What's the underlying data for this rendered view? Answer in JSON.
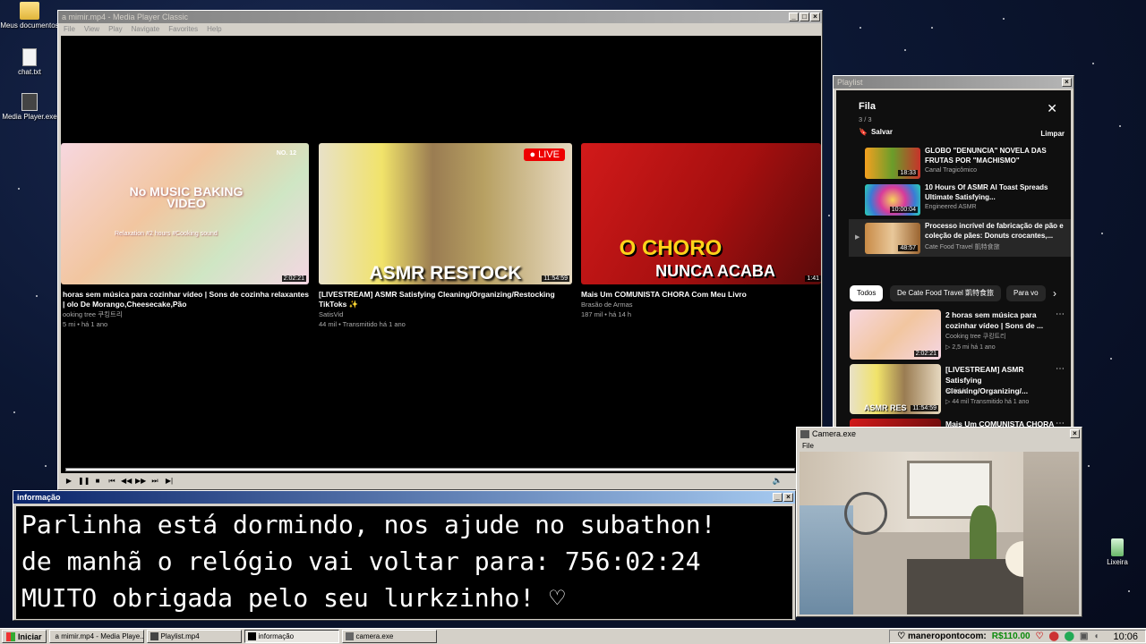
{
  "desktop": {
    "icons": [
      {
        "label": "Meus documentos"
      },
      {
        "label": "chat.txt"
      },
      {
        "label": "Media Player.exe"
      },
      {
        "label": "Lixeira"
      }
    ]
  },
  "mpc": {
    "title": "a mimir.mp4 - Media Player Classic",
    "menu": [
      "File",
      "View",
      "Play",
      "Navigate",
      "Favorites",
      "Help"
    ],
    "videos": [
      {
        "title": "horas sem música para cozinhar vídeo | Sons de cozinha relaxantes | olo De Morango,Cheesecake,Pão",
        "channel": "ooking tree 쿠킹트리",
        "meta": "5 mi • há 1 ano",
        "duration": "2:02:21",
        "thumb_text": "No MUSIC BAKING VIDEO",
        "thumb_sub": "Relaxation #2 hours #Cooking sound",
        "thumb_badge": "NO. 12"
      },
      {
        "title": "[LIVESTREAM] ASMR Satisfying Cleaning/Organizing/Restocking TikToks ✨",
        "channel": "SatisVid",
        "meta": "44 mil • Transmitido há 1 ano",
        "duration": "11:54:59",
        "thumb_text": "ASMR RESTOCK",
        "live_label": "LIVE"
      },
      {
        "title": "Mais Um COMUNISTA CHORA Com Meu Livro",
        "channel": "Brasão de Armas",
        "meta": "187 mil • há 14 h",
        "duration": "1:41",
        "thumb_text_1": "O CHORO",
        "thumb_text_2": "NUNCA ACABA"
      }
    ]
  },
  "playlist": {
    "window_title": "Playlist",
    "header": "Fila",
    "count": "3 / 3",
    "save_label": "Salvar",
    "clear_label": "Limpar",
    "queue": [
      {
        "title": "GLOBO \"DENUNCIA\" NOVELA DAS FRUTAS POR \"MACHISMO\"",
        "channel": "Canal Tragicômico",
        "duration": "18:33"
      },
      {
        "title": "10 Hours Of ASMR AI Toast Spreads Ultimate Satisfying...",
        "channel": "Engineered ASMR",
        "duration": "10:00:04"
      },
      {
        "title": "Processo incrível de fabricação de pão e coleção de pães: Donuts crocantes,...",
        "channel": "Cate Food Travel 凱特食旅",
        "duration": "48:57"
      }
    ],
    "chips": [
      "Todos",
      "De Cate Food Travel 凱特食旅",
      "Para vo"
    ],
    "related": [
      {
        "title": "2 horas sem música para cozinhar vídeo | Sons de ...",
        "channel": "Cooking tree 쿠킹트리",
        "meta": "▷ 2,5 mi   há 1 ano",
        "duration": "2:02:21"
      },
      {
        "title": "[LIVESTREAM] ASMR Satisfying Cleaning/Organizing/...",
        "channel": "SatisVid",
        "meta": "▷ 44 mil   Transmitido há 1 ano",
        "duration": "11:54:59",
        "thumb_text": "ASMR RES"
      },
      {
        "title": "Mais Um COMUNISTA CHORA Com Meu Livro",
        "channel": "",
        "meta": "",
        "duration": ""
      }
    ]
  },
  "info": {
    "title": "informação",
    "lines": [
      "Parlinha está dormindo, nos ajude no subathon!",
      "de manhã o relógio vai voltar para:  756:02:24",
      "MUITO obrigada pelo seu lurkzinho! ♡"
    ]
  },
  "camera": {
    "title": "Camera.exe",
    "menu": "File"
  },
  "taskbar": {
    "start_label": "Iniciar",
    "tasks": [
      "a mimir.mp4 - Media Playe...",
      "Playlist.mp4",
      "informação",
      "camera.exe"
    ],
    "tray_user": "♡ maneropontocom:",
    "tray_money": "R$110.00",
    "clock": "10:06"
  }
}
